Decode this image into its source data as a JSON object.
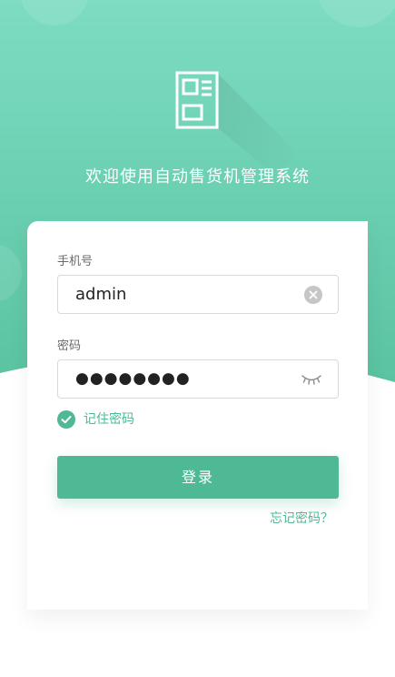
{
  "header": {
    "title": "欢迎使用自动售货机管理系统",
    "logo_icon": "document-icon"
  },
  "form": {
    "phone_label": "手机号",
    "phone_value": "admin",
    "password_label": "密码",
    "password_value": "●●●●●●●●",
    "remember_label": "记住密码",
    "remember_checked": true,
    "login_label": "登录",
    "forgot_label": "忘记密码？"
  },
  "colors": {
    "primary": "#4fb996",
    "gradient_top": "#7ddcc3",
    "gradient_bottom": "#5cc4a2",
    "background": "#ffffff"
  }
}
